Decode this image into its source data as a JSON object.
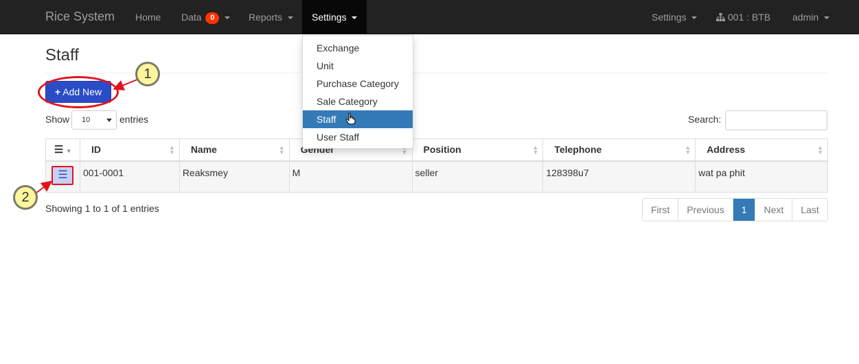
{
  "navbar": {
    "brand": "Rice System",
    "items": [
      {
        "label": "Home"
      },
      {
        "label": "Data",
        "badge": "0"
      },
      {
        "label": "Reports"
      },
      {
        "label": "Settings"
      }
    ],
    "right_items": [
      {
        "label": "Settings"
      },
      {
        "label": "001 : BTB",
        "icon": "sitemap-icon"
      },
      {
        "label": "admin"
      }
    ]
  },
  "dropdown": {
    "items": [
      "Exchange",
      "Unit",
      "Purchase Category",
      "Sale Category",
      "Staff",
      "User Staff"
    ],
    "active": "Staff"
  },
  "page": {
    "title": "Staff",
    "add_button": "Add New"
  },
  "entries": {
    "show_label": "Show",
    "value": "10",
    "suffix_label": "entries"
  },
  "search": {
    "label": "Search:"
  },
  "table": {
    "columns": [
      "ID",
      "Name",
      "Gender",
      "Position",
      "Telephone",
      "Address"
    ],
    "rows": [
      {
        "id": "001-0001",
        "name": "Reaksmey",
        "gender": "M",
        "position": "seller",
        "telephone": "128398u7",
        "address": "wat pa phit"
      }
    ]
  },
  "info": "Showing 1 to 1 of 1 entries",
  "pagination": [
    "First",
    "Previous",
    "1",
    "Next",
    "Last"
  ],
  "annotations": [
    "1",
    "2"
  ],
  "colors": {
    "navbar": "#222222",
    "accent": "#337ab7",
    "add_button": "#2a4cc7",
    "annotation_red": "#e0141e",
    "badge": "#ff3300"
  }
}
